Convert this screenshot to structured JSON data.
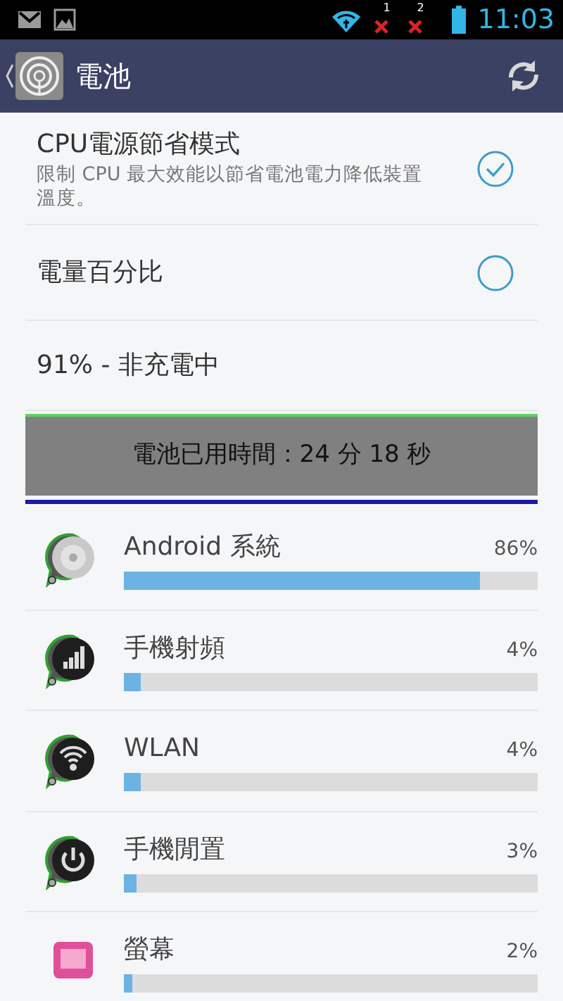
{
  "status_bar": {
    "sim_labels": [
      "1",
      "2"
    ],
    "time": "11:03"
  },
  "app_bar": {
    "title": "電池"
  },
  "settings": [
    {
      "kind": "checkbox",
      "title": "CPU電源節省模式",
      "summary": "限制 CPU 最大效能以節省電池電力降低裝置溫度。",
      "checked": true
    },
    {
      "kind": "checkbox",
      "title": "電量百分比",
      "checked": false
    },
    {
      "kind": "text",
      "title": "91% - 非充電中"
    }
  ],
  "usage_banner": {
    "text": "電池已用時間：24 分 18 秒"
  },
  "usage": [
    {
      "kind": "system",
      "name": "Android 系統",
      "percent": "86%",
      "level": 0.86
    },
    {
      "kind": "signal",
      "name": "手機射頻",
      "percent": "4%",
      "level": 0.04
    },
    {
      "kind": "wifi",
      "name": "WLAN",
      "percent": "4%",
      "level": 0.04
    },
    {
      "kind": "power",
      "name": "手機閒置",
      "percent": "3%",
      "level": 0.03
    },
    {
      "kind": "screen",
      "name": "螢幕",
      "percent": "2%",
      "level": 0.02
    }
  ]
}
